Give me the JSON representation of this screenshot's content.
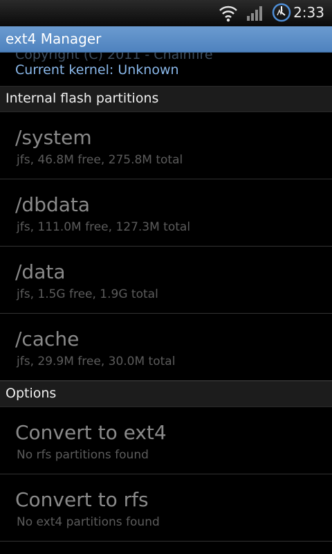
{
  "status_bar": {
    "time": "2:33",
    "icons": [
      "wifi-icon",
      "signal-icon",
      "clock-sync-icon"
    ]
  },
  "app": {
    "title": "ext4 Manager"
  },
  "header_info": {
    "copyright": "Copyright (C) 2011 - Chainfire",
    "kernel": "Current kernel: Unknown"
  },
  "sections": {
    "partitions_header": "Internal flash partitions",
    "options_header": "Options"
  },
  "partitions": [
    {
      "name": "/system",
      "detail": "jfs, 46.8M free, 275.8M total"
    },
    {
      "name": "/dbdata",
      "detail": "jfs, 111.0M free, 127.3M total"
    },
    {
      "name": "/data",
      "detail": "jfs, 1.5G free, 1.9G total"
    },
    {
      "name": "/cache",
      "detail": "jfs, 29.9M free, 30.0M total"
    }
  ],
  "options": [
    {
      "name": "Convert to ext4",
      "detail": "No rfs partitions found"
    },
    {
      "name": "Convert to rfs",
      "detail": "No ext4 partitions found"
    }
  ],
  "colors": {
    "title_bar": "#5a8fcb",
    "kernel_text": "#8ab8ea",
    "primary_text": "#8a8a8a",
    "secondary_text": "#5c5c5c"
  }
}
